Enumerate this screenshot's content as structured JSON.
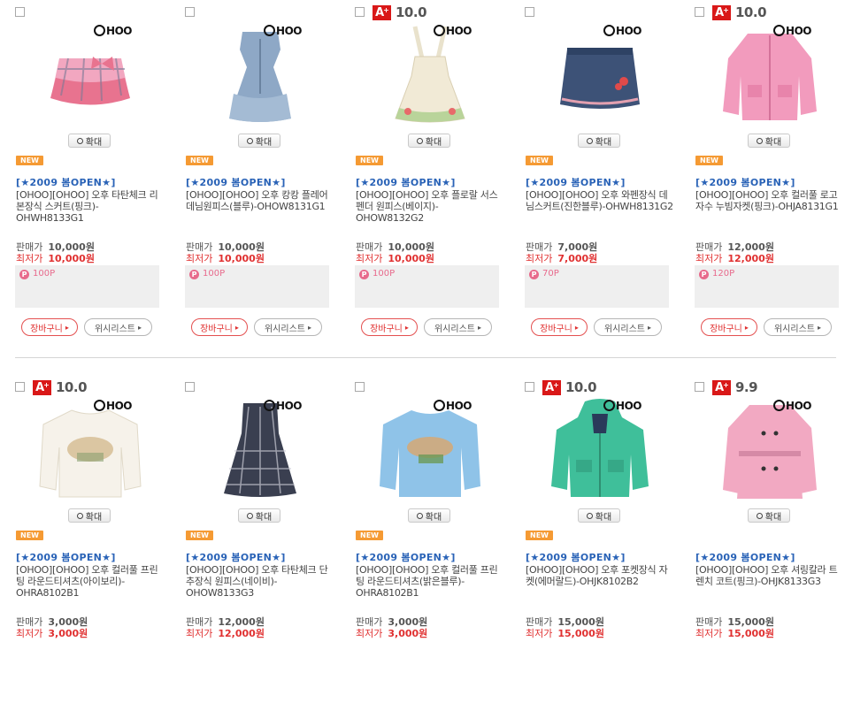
{
  "labels": {
    "zoom": "확대",
    "new_badge": "NEW",
    "event": "[★2009 봄OPEN★]",
    "sale_price": "판매가",
    "lowest_price": "최저가",
    "cart": "장바구니",
    "wishlist": "위시리스트",
    "brand": "HOO"
  },
  "products": [
    {
      "grade": "",
      "name": "[OHOO][OHOO] 오후 타탄체크 리본장식 스커트(핑크)-OHWH8133G1",
      "price": "10,000원",
      "lowest": "10,000원",
      "points": "100P",
      "new": true
    },
    {
      "grade": "",
      "name": "[OHOO][OHOO] 오후 캉캉 플레어 데님원피스(블루)-OHOW8131G1",
      "price": "10,000원",
      "lowest": "10,000원",
      "points": "100P",
      "new": true
    },
    {
      "grade": "10.0",
      "name": "[OHOO][OHOO] 오후 플로랄 서스펜더 원피스(베이지)-OHOW8132G2",
      "price": "10,000원",
      "lowest": "10,000원",
      "points": "100P",
      "new": true
    },
    {
      "grade": "",
      "name": "[OHOO][OHOO] 오후 와펜장식 데님스커트(진한블루)-OHWH8131G2",
      "price": "7,000원",
      "lowest": "7,000원",
      "points": "70P",
      "new": true
    },
    {
      "grade": "10.0",
      "name": "[OHOO][OHOO] 오후 컬러풀 로고자수 누빔자켓(핑크)-OHJA8131G1",
      "price": "12,000원",
      "lowest": "12,000원",
      "points": "120P",
      "new": true
    },
    {
      "grade": "10.0",
      "name": "[OHOO][OHOO] 오후 컬러풀 프린팅 라운드티셔츠(아이보리)-OHRA8102B1",
      "price": "3,000원",
      "lowest": "3,000원",
      "points": "",
      "new": true
    },
    {
      "grade": "",
      "name": "[OHOO][OHOO] 오후 타탄체크 단추장식 원피스(네이비)-OHOW8133G3",
      "price": "12,000원",
      "lowest": "12,000원",
      "points": "",
      "new": true
    },
    {
      "grade": "",
      "name": "[OHOO][OHOO] 오후 컬러풀 프린팅 라운드티셔츠(밝은블루)-OHRA8102B1",
      "price": "3,000원",
      "lowest": "3,000원",
      "points": "",
      "new": true
    },
    {
      "grade": "10.0",
      "name": "[OHOO][OHOO] 오후 포켓장식 자켓(에머랄드)-OHJK8102B2",
      "price": "15,000원",
      "lowest": "15,000원",
      "points": "",
      "new": true
    },
    {
      "grade": "9.9",
      "name": "[OHOO][OHOO] 오후 셔링칼라 트렌치 코트(핑크)-OHJK8133G3",
      "price": "15,000원",
      "lowest": "15,000원",
      "points": "",
      "new": false
    }
  ]
}
